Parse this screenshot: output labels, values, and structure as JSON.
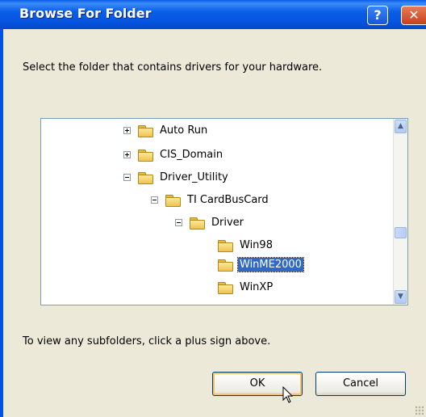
{
  "window": {
    "title": "Browse For Folder",
    "help_label": "?",
    "close_label": "✕"
  },
  "instruction": "Select the folder that contains drivers for your hardware.",
  "tree": {
    "items": [
      {
        "label": "Auto Run",
        "expander": "plus"
      },
      {
        "label": "CIS_Domain",
        "expander": "plus"
      },
      {
        "label": "Driver_Utility",
        "expander": "minus"
      },
      {
        "label": "TI CardBusCard",
        "expander": "minus"
      },
      {
        "label": "Driver",
        "expander": "minus"
      },
      {
        "label": "Win98",
        "expander": "none"
      },
      {
        "label": "WinME2000",
        "expander": "none",
        "selected": true
      },
      {
        "label": "WinXP",
        "expander": "none"
      }
    ]
  },
  "hint": "To view any subfolders, click a plus sign above.",
  "buttons": {
    "ok": "OK",
    "cancel": "Cancel"
  },
  "colors": {
    "titlebar": "#0a5ee8",
    "selection": "#316ac5",
    "dialog_bg": "#ece9d8"
  }
}
